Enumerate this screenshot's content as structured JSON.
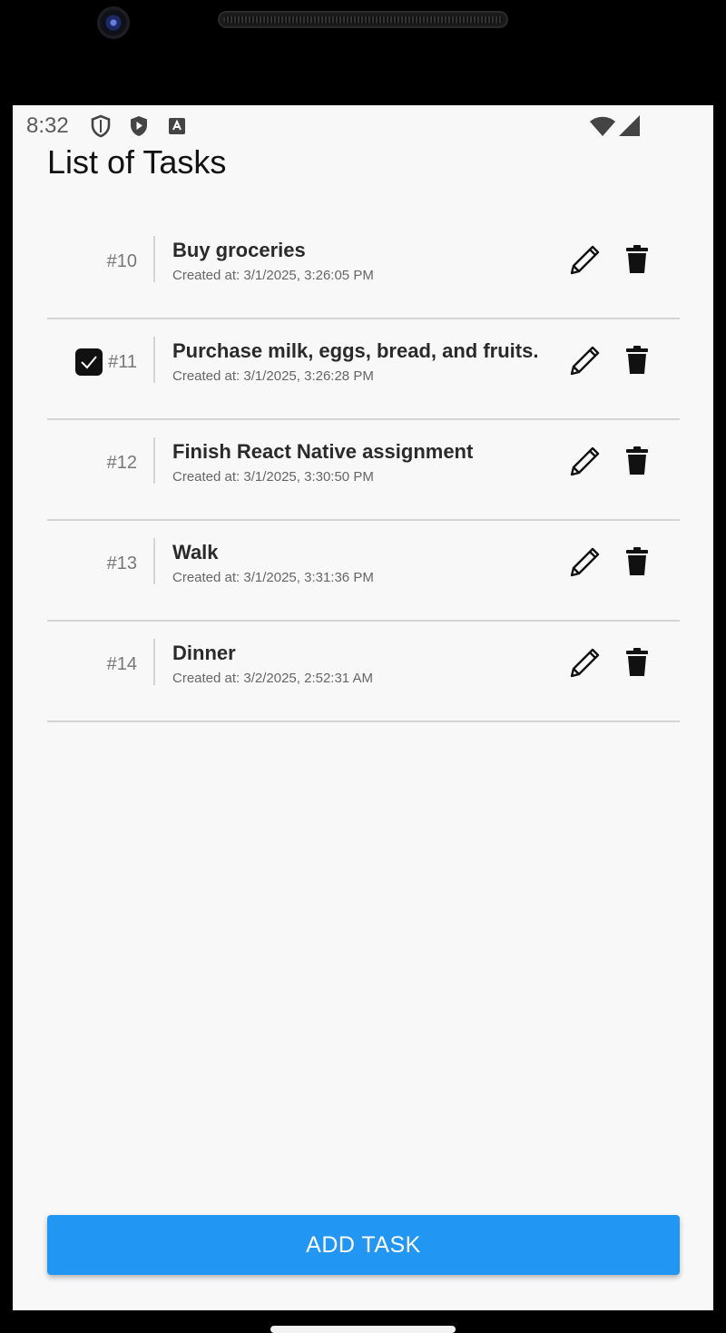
{
  "status_bar": {
    "time": "8:32",
    "icons": [
      "shield-outline-icon",
      "shield-play-icon",
      "font-a-icon",
      "wifi-icon",
      "signal-icon"
    ]
  },
  "page": {
    "title": "List of Tasks"
  },
  "tasks": [
    {
      "number": "#10",
      "title": "Buy groceries",
      "created": "Created at: 3/1/2025, 3:26:05 PM",
      "checked": false
    },
    {
      "number": "#11",
      "title": "Purchase milk, eggs, bread, and fruits.",
      "created": "Created at: 3/1/2025, 3:26:28 PM",
      "checked": true
    },
    {
      "number": "#12",
      "title": "Finish React Native assignment",
      "created": "Created at: 3/1/2025, 3:30:50 PM",
      "checked": false
    },
    {
      "number": "#13",
      "title": "Walk",
      "created": "Created at: 3/1/2025, 3:31:36 PM",
      "checked": false
    },
    {
      "number": "#14",
      "title": "Dinner",
      "created": "Created at: 3/2/2025, 2:52:31 AM",
      "checked": false
    }
  ],
  "actions": {
    "add_task_label": "ADD TASK"
  },
  "colors": {
    "accent": "#2196f3",
    "background": "#f8f8f9",
    "divider": "#d4d4d6"
  }
}
